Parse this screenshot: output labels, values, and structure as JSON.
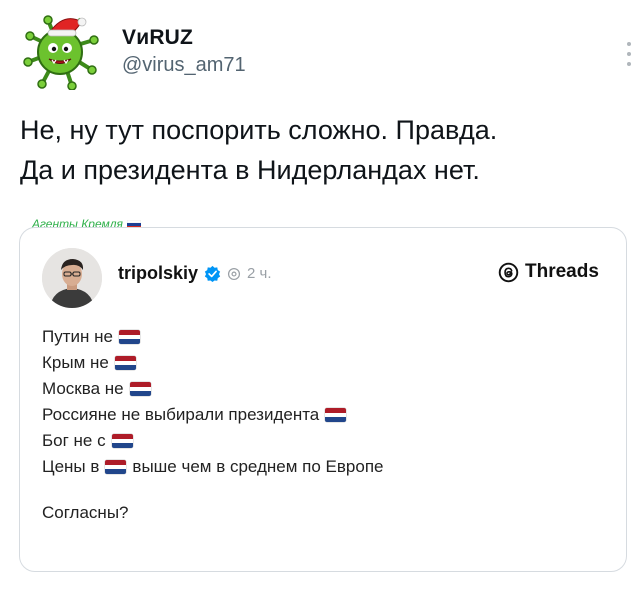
{
  "tweet": {
    "author_name": "VиRUZ",
    "author_handle": "@virus_am71",
    "text_lines": [
      "Не, ну тут поспорить сложно. Правда.",
      "Да и президента в Нидерландах нет."
    ]
  },
  "channel_tag": "Агенты Кремля",
  "quote": {
    "username": "tripolskiy",
    "time": "2 ч.",
    "platform": "Threads",
    "lines": [
      {
        "before": "Путин не",
        "flag": "nl-flag",
        "after": ""
      },
      {
        "before": "Крым не",
        "flag": "nl-flag",
        "after": ""
      },
      {
        "before": "Москва не",
        "flag": "nl-flag",
        "after": ""
      },
      {
        "before": "Россияне не выбирали президента",
        "flag": "nl-flag",
        "after": ""
      },
      {
        "before": "Бог не с",
        "flag": "nl-flag",
        "after": ""
      },
      {
        "before": "Цены в",
        "flag": "nl-flag",
        "after": "выше чем в среднем по Европе"
      }
    ],
    "closing": "Согласны?"
  },
  "colors": {
    "channel_green": "#2fb04a",
    "verified_blue": "#0095f6",
    "handle_gray": "#536471",
    "nl_red": "#ae1c28",
    "nl_blue": "#21468b"
  },
  "icons": {
    "avatar": "green-virus-santa-hat",
    "verified": "verified-badge-icon",
    "repost": "repost-icon",
    "threads": "threads-logo-icon",
    "more": "more-vertical-icon"
  }
}
